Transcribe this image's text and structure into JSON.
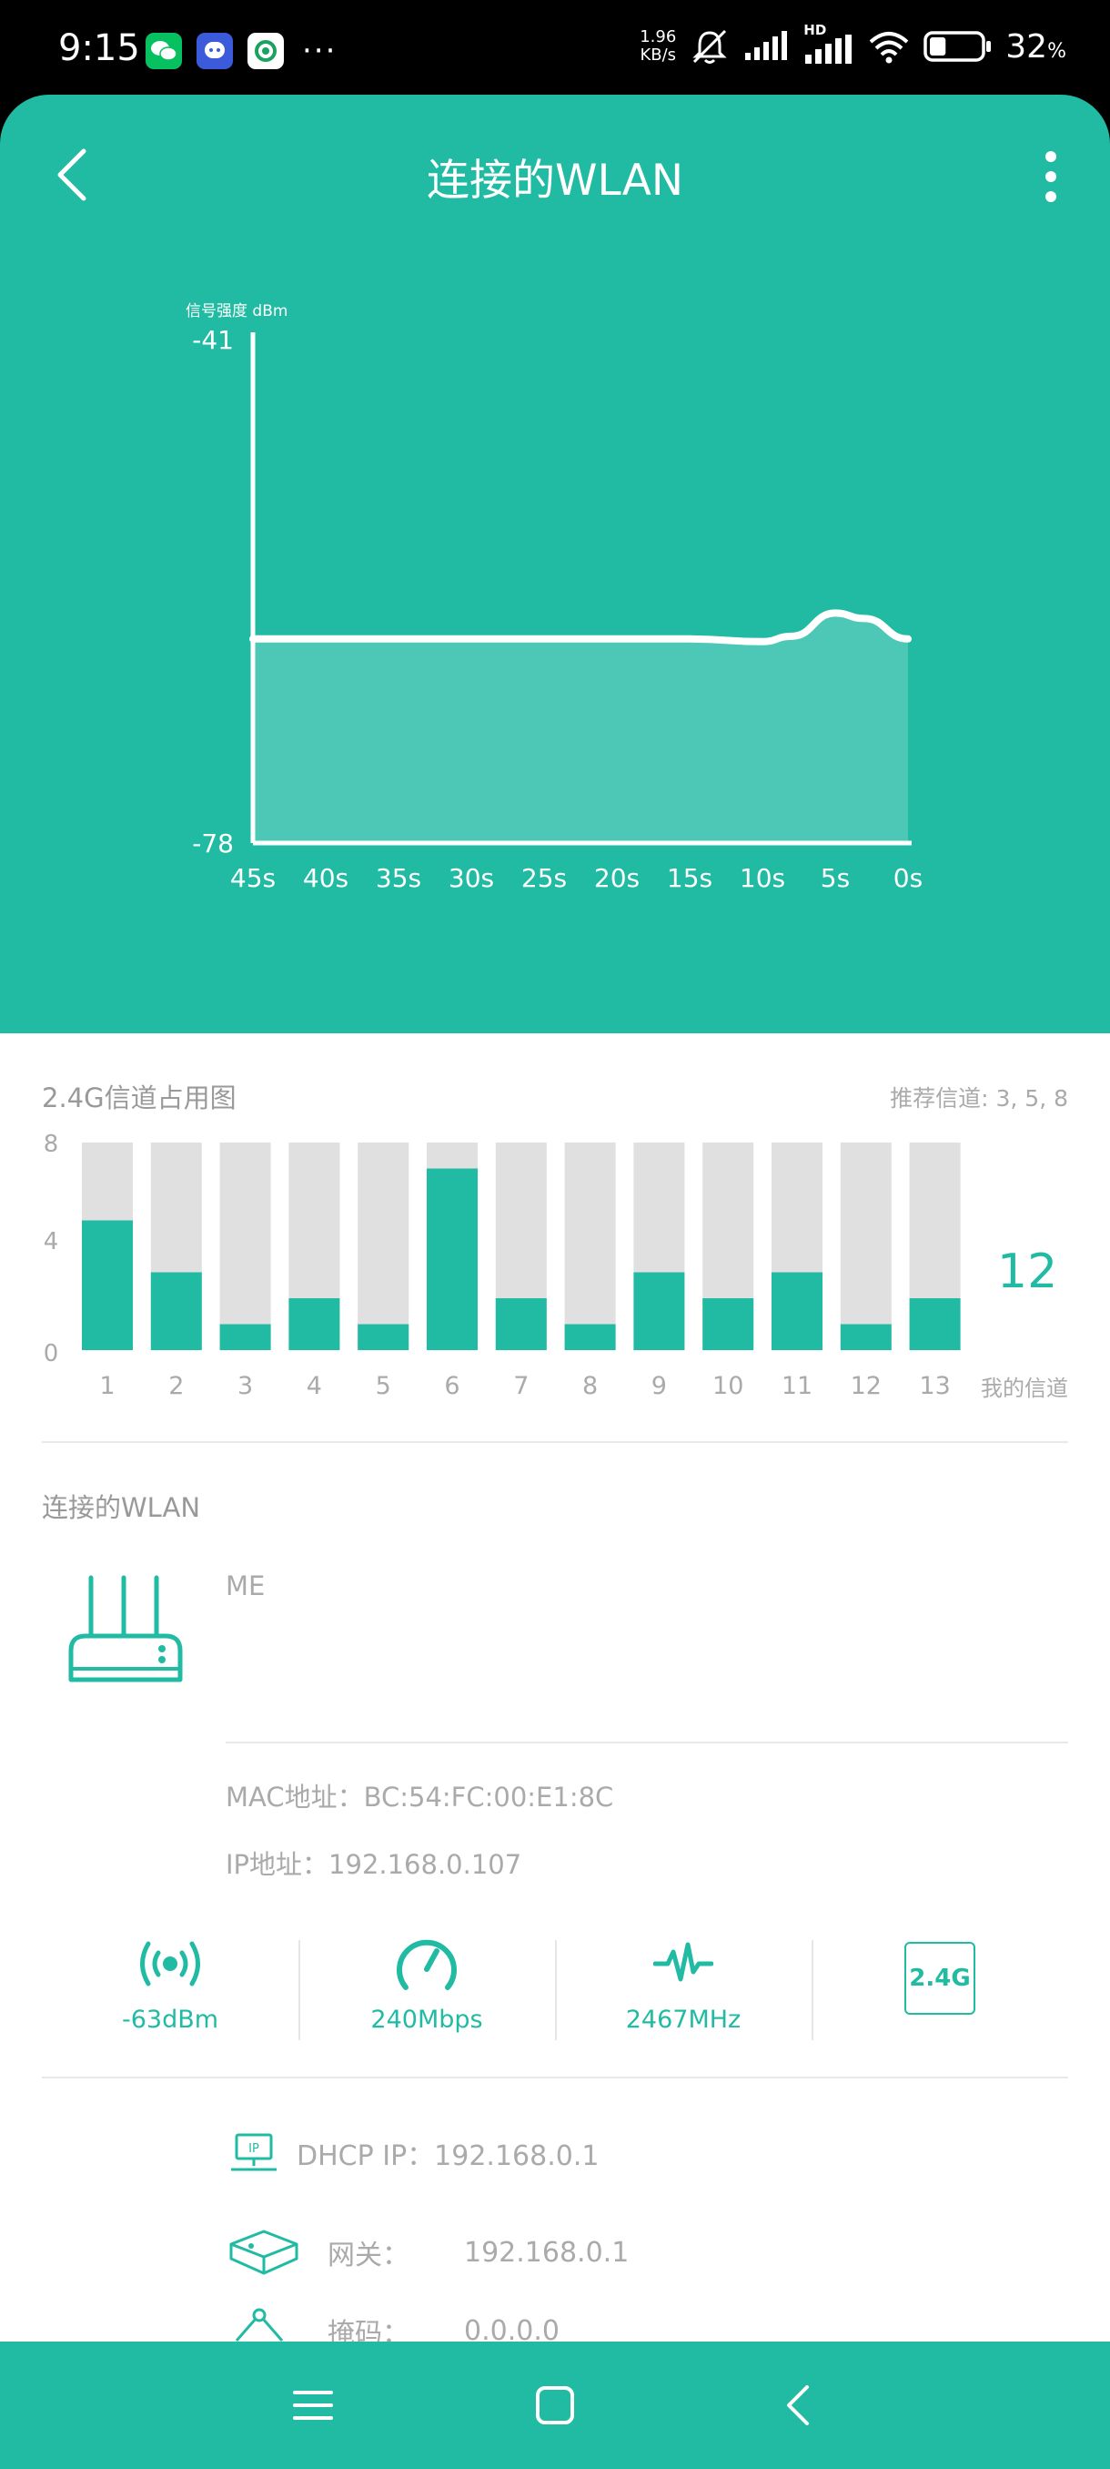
{
  "status_bar": {
    "time": "9:15",
    "net_speed_value": "1.96",
    "net_speed_unit": "KB/s",
    "network_label": "HD",
    "battery_percent": "32",
    "battery_unit": "%",
    "battery_level": 0.32
  },
  "header": {
    "title": "连接的WLAN"
  },
  "chart_data": [
    {
      "type": "area",
      "ylabel": "信号强度 dBm",
      "ylim": [
        -78,
        -41
      ],
      "y_ticks": [
        "-41",
        "-78"
      ],
      "x_tick_labels": [
        "45s",
        "40s",
        "35s",
        "30s",
        "25s",
        "20s",
        "15s",
        "10s",
        "5s",
        "0s"
      ],
      "x": [
        45,
        40,
        35,
        30,
        25,
        20,
        15,
        10,
        8,
        5,
        3,
        0
      ],
      "values": [
        -63,
        -63,
        -63,
        -63,
        -63,
        -63,
        -63,
        -63.2,
        -62.8,
        -61.1,
        -61.5,
        -63
      ]
    },
    {
      "type": "bar",
      "title": "2.4G信道占用图",
      "categories": [
        "1",
        "2",
        "3",
        "4",
        "5",
        "6",
        "7",
        "8",
        "9",
        "10",
        "11",
        "12",
        "13"
      ],
      "values": [
        5,
        3,
        1,
        2,
        1,
        7,
        2,
        1,
        3,
        2,
        3,
        1,
        2
      ],
      "ylim": [
        0,
        8
      ],
      "y_ticks": [
        "8",
        "4",
        "0"
      ]
    }
  ],
  "channels": {
    "recommended": "推荐信道: 3, 5, 8",
    "my_channel": "12",
    "my_channel_label": "我的信道"
  },
  "wlan": {
    "section_title": "连接的WLAN",
    "ssid": "ME",
    "mac": "MAC地址：BC:54:FC:00:E1:8C",
    "ip": "IP地址：192.168.0.107"
  },
  "stats": {
    "signal": "-63dBm",
    "speed": "240Mbps",
    "frequency": "2467MHz",
    "band": "2.4G"
  },
  "details": {
    "dhcp": "DHCP IP：192.168.0.1",
    "gateway_label": "网关：",
    "gateway_value": "192.168.0.1",
    "mask_label": "掩码：",
    "mask_value": "0.0.0.0"
  },
  "colors": {
    "accent": "#21bba4",
    "bar_empty": "#e0e0e0"
  }
}
